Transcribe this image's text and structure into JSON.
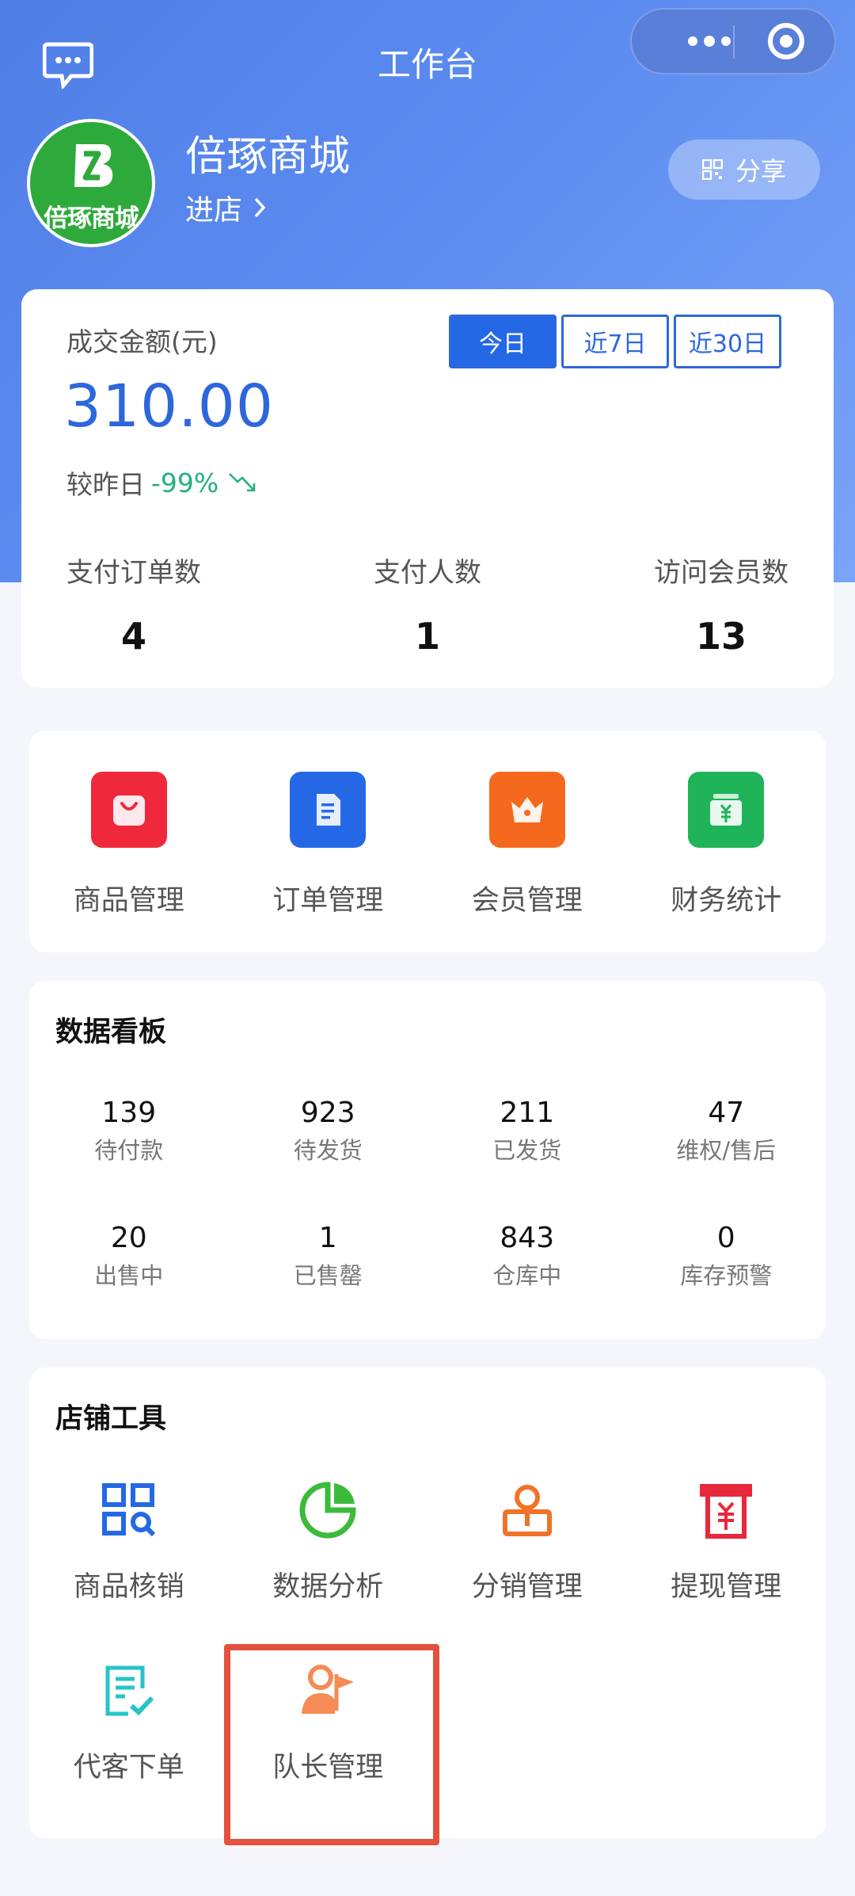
{
  "nav": {
    "title": "工作台"
  },
  "shop": {
    "logo_text": "倍琢商城",
    "name": "倍琢商城",
    "enter_label": "进店",
    "share_label": "分享"
  },
  "stats": {
    "amount_label": "成交金额(元)",
    "amount": "310.00",
    "compare_label": "较昨日",
    "compare_value": "-99%",
    "tabs": [
      "今日",
      "近7日",
      "近30日"
    ],
    "active_tab": 0,
    "metrics": [
      {
        "label": "支付订单数",
        "value": "4"
      },
      {
        "label": "支付人数",
        "value": "1"
      },
      {
        "label": "访问会员数",
        "value": "13"
      }
    ]
  },
  "menu": [
    {
      "label": "商品管理",
      "icon": "shopping-bag-icon",
      "color": "#f0283c"
    },
    {
      "label": "订单管理",
      "icon": "order-document-icon",
      "color": "#2468e5"
    },
    {
      "label": "会员管理",
      "icon": "crown-icon",
      "color": "#f5691e"
    },
    {
      "label": "财务统计",
      "icon": "yuan-wallet-icon",
      "color": "#1fb45a"
    }
  ],
  "board": {
    "title": "数据看板",
    "rows": [
      [
        {
          "value": "139",
          "label": "待付款"
        },
        {
          "value": "923",
          "label": "待发货"
        },
        {
          "value": "211",
          "label": "已发货"
        },
        {
          "value": "47",
          "label": "维权/售后"
        }
      ],
      [
        {
          "value": "20",
          "label": "出售中"
        },
        {
          "value": "1",
          "label": "已售罄"
        },
        {
          "value": "843",
          "label": "仓库中"
        },
        {
          "value": "0",
          "label": "库存预警"
        }
      ]
    ]
  },
  "tools": {
    "title": "店铺工具",
    "rows": [
      [
        {
          "label": "商品核销",
          "icon": "qr-scan-icon",
          "color": "#2468e5"
        },
        {
          "label": "数据分析",
          "icon": "pie-chart-icon",
          "color": "#3cba3c"
        },
        {
          "label": "分销管理",
          "icon": "distribution-icon",
          "color": "#f07328"
        },
        {
          "label": "提现管理",
          "icon": "withdraw-icon",
          "color": "#e8283c"
        }
      ],
      [
        {
          "label": "代客下单",
          "icon": "checklist-icon",
          "color": "#28c3c8"
        },
        {
          "label": "队长管理",
          "icon": "captain-flag-icon",
          "color": "#f58c55"
        }
      ]
    ]
  },
  "colors": {
    "primary": "#2468e5",
    "highlight": "#e4513e",
    "up_green": "#22b07a"
  }
}
